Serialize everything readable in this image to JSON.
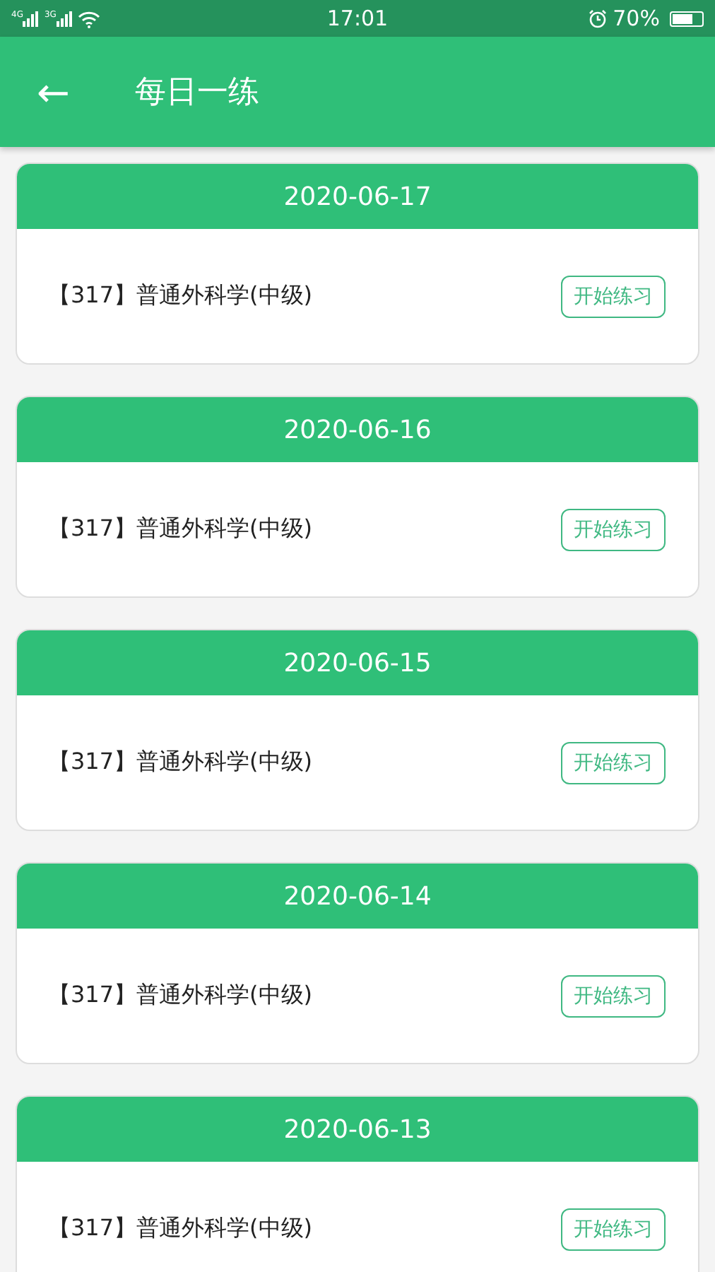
{
  "status_bar": {
    "networks": [
      "4G",
      "3G"
    ],
    "time": "17:01",
    "battery_text": "70%"
  },
  "app_bar": {
    "back": "←",
    "title": "每日一练"
  },
  "cards": [
    {
      "date": "2020-06-17",
      "subject": "【317】普通外科学(中级)",
      "action": "开始练习"
    },
    {
      "date": "2020-06-16",
      "subject": "【317】普通外科学(中级)",
      "action": "开始练习"
    },
    {
      "date": "2020-06-15",
      "subject": "【317】普通外科学(中级)",
      "action": "开始练习"
    },
    {
      "date": "2020-06-14",
      "subject": "【317】普通外科学(中级)",
      "action": "开始练习"
    },
    {
      "date": "2020-06-13",
      "subject": "【317】普通外科学(中级)",
      "action": "开始练习"
    }
  ]
}
